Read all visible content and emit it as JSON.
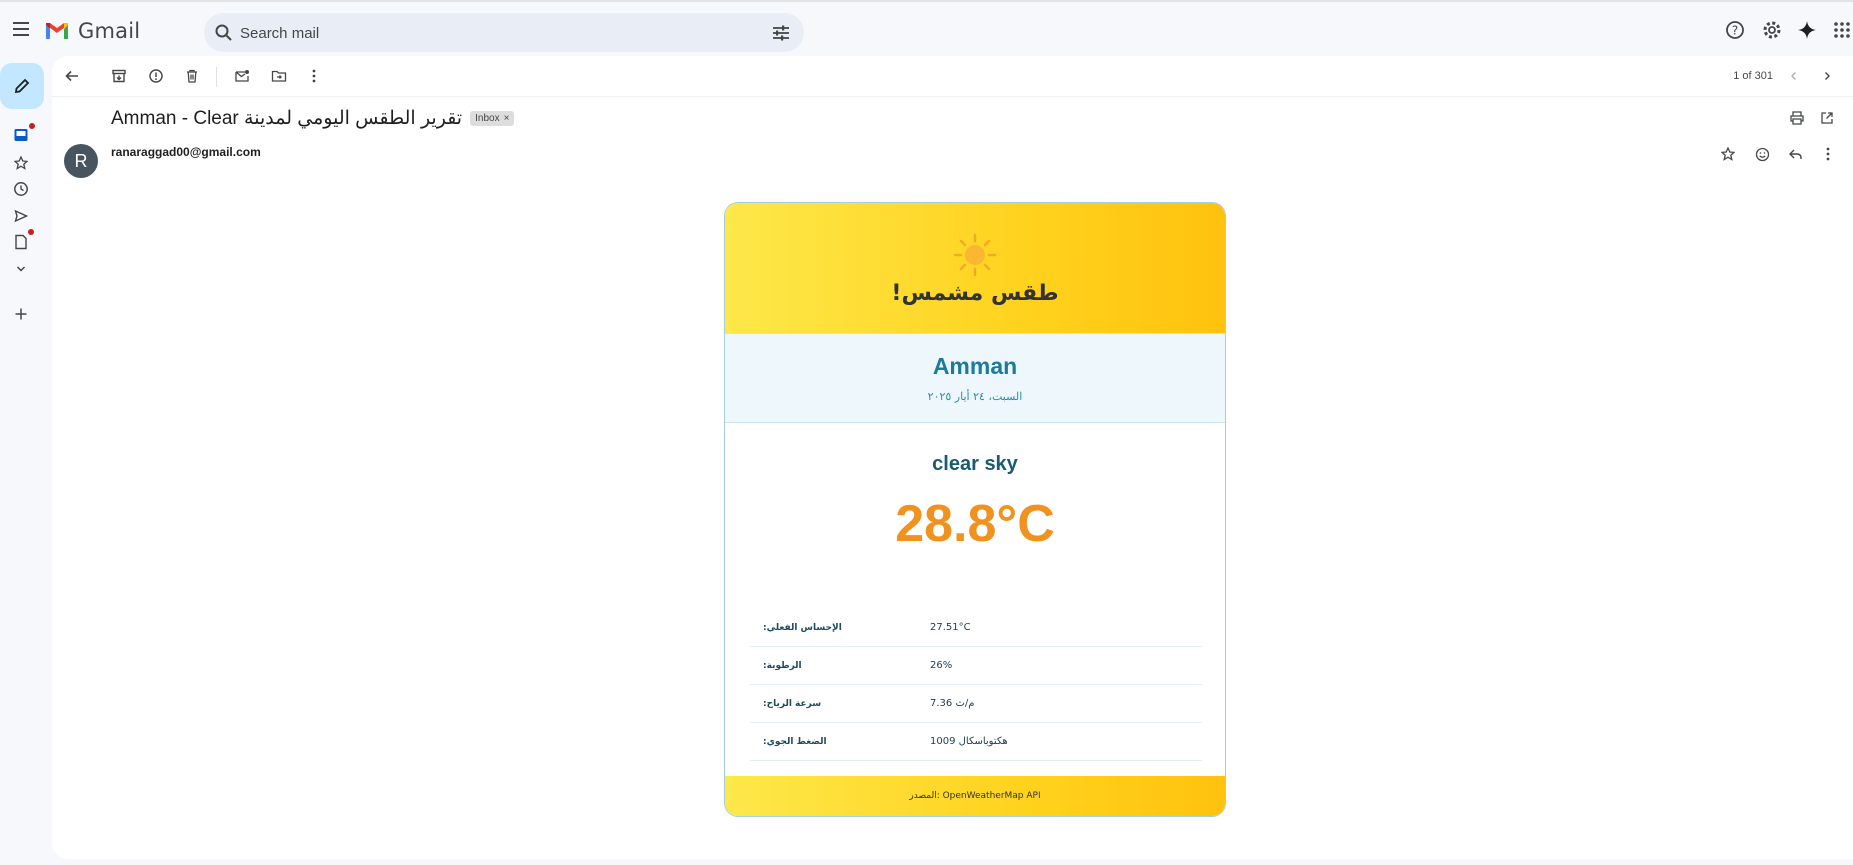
{
  "app": {
    "name": "Gmail"
  },
  "search": {
    "placeholder": "Search mail"
  },
  "toolbar": {
    "pager": "1 of 301"
  },
  "email": {
    "subject": "Amman - Clear تقرير الطقس اليومي لمدينة",
    "label": "Inbox",
    "label_remove": "×",
    "sender": "ranaraggad00@gmail.com",
    "avatar_initial": "R"
  },
  "weather_card": {
    "icon": "sun-icon",
    "title": "!طقس مشمس",
    "city": "Amman",
    "date": "السبت، ٢٤ أيار ٢٠٢٥",
    "description": "clear sky",
    "temperature": "28.8°C",
    "stats": [
      {
        "label": ":الإحساس الفعلي",
        "value": "27.51°C"
      },
      {
        "label": ":الرطوبة",
        "value": "26%"
      },
      {
        "label": ":سرعة الرياح",
        "value": "7.36 م/ث"
      },
      {
        "label": ":الضغط الجوي",
        "value": "1009 هكتوباسكال"
      }
    ],
    "footer": "المصدر: OpenWeatherMap API"
  },
  "colors": {
    "accent": "#c2e7ff",
    "city": "#1c7a9c",
    "temperature": "#f0921f",
    "sun_gradient_start": "#fde84a",
    "sun_gradient_end": "#ffc20e",
    "avatar": "#46555f"
  }
}
